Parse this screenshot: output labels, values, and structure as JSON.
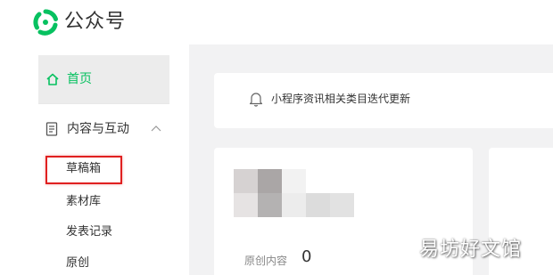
{
  "header": {
    "brand": "公众号",
    "logo_icon": "wechat-official-account-logo",
    "accent_color": "#07c160"
  },
  "sidebar": {
    "home": {
      "label": "首页",
      "icon": "home-icon",
      "active": true
    },
    "group": {
      "label": "内容与互动",
      "icon": "document-icon",
      "expanded": true
    },
    "sub_items": [
      {
        "label": "草稿箱",
        "highlighted": true
      },
      {
        "label": "素材库"
      },
      {
        "label": "发表记录"
      },
      {
        "label": "原创"
      }
    ]
  },
  "notice": {
    "icon": "bell-icon",
    "text": "小程序资讯相关类目迭代更新"
  },
  "stats": {
    "original_label": "原创内容",
    "original_value": "0"
  },
  "watermark": "易坊好文馆",
  "colors": {
    "highlight_box": "#e02020",
    "page_background": "#f2f2f3"
  }
}
